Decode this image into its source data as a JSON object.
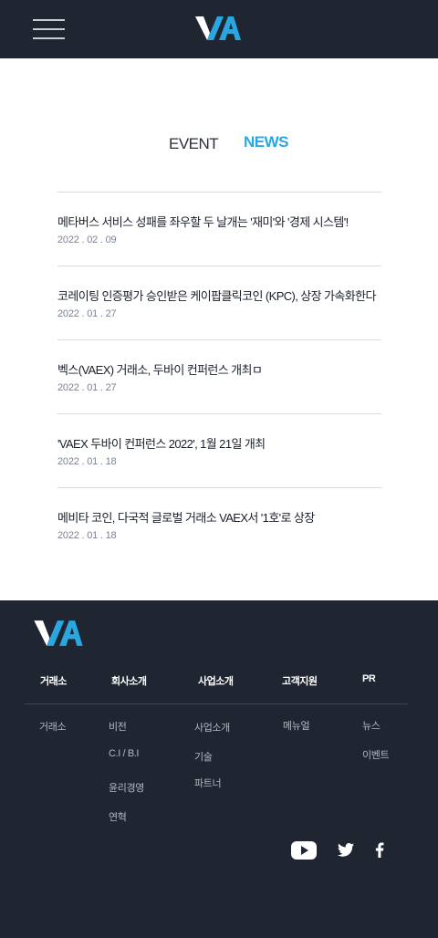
{
  "header": {
    "menu_icon": "hamburger-menu-icon",
    "logo_text": "VA"
  },
  "tabs": [
    {
      "label": "EVENT",
      "active": false
    },
    {
      "label": "NEWS",
      "active": true
    }
  ],
  "news": [
    {
      "title": "메타버스 서비스 성패를 좌우할 두 날개는 '재미'와 '경제 시스템'!",
      "date": "2022 . 02 . 09"
    },
    {
      "title": "코레이팅 인증평가 승인받은 케이팝클릭코인 (KPC), 상장 가속화한다",
      "date": "2022 . 01 . 27"
    },
    {
      "title": "벡스(VAEX) 거래소, 두바이 컨퍼런스 개최ㅁ",
      "date": "2022 . 01 . 27"
    },
    {
      "title": "'VAEX 두바이 컨퍼런스 2022', 1월 21일 개최",
      "date": "2022 . 01 . 18"
    },
    {
      "title": "메비타 코인, 다국적 글로벌 거래소 VAEX서 '1호'로 상장",
      "date": "2022 . 01 . 18"
    }
  ],
  "footer": {
    "logo_text": "VA",
    "columns": [
      {
        "heading": "거래소",
        "links": [
          "거래소"
        ]
      },
      {
        "heading": "회사소개",
        "links": [
          "비전",
          "C.I / B.I",
          "윤리경영",
          "연혁"
        ]
      },
      {
        "heading": "사업소개",
        "links": [
          "사업소개",
          "기술",
          "파트너"
        ]
      },
      {
        "heading": "고객지원",
        "links": [
          "메뉴얼"
        ]
      },
      {
        "heading": "PR",
        "links": [
          "뉴스",
          "이벤트"
        ]
      }
    ],
    "social": [
      "youtube-icon",
      "twitter-icon",
      "facebook-icon"
    ]
  },
  "colors": {
    "dark_bg": "#1f2632",
    "accent": "#2ba7e0",
    "text": "#1a1f2b",
    "date": "#7b8190"
  }
}
